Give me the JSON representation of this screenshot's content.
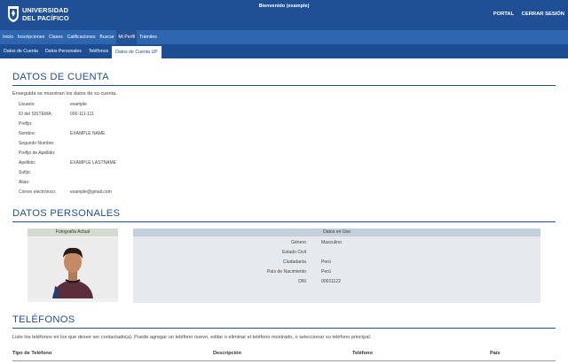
{
  "header": {
    "logo_line1": "UNIVERSIDAD",
    "logo_line2": "DEL PACÍFICO",
    "welcome": "Bienvenido (example)",
    "link_portal": "PORTAL",
    "link_logout": "CERRAR SESIÓN"
  },
  "menu": {
    "items": [
      "Inicio",
      "Inscripciones",
      "Clases",
      "Calificaciones",
      "Buscar",
      "Mi Perfil",
      "Trámites"
    ],
    "active": "Mi Perfil"
  },
  "submenu": {
    "items": [
      "Datos de Cuenta",
      "Datos Personales",
      "Teléfonos",
      "Datos de Cuenta UP"
    ],
    "active": "Datos de Cuenta UP"
  },
  "cuenta": {
    "title": "DATOS DE CUENTA",
    "intro": "Enseguida se muestran los datos de su cuenta.",
    "fields": [
      {
        "label": "Usuario:",
        "value": "example"
      },
      {
        "label": "ID del SISTEMA:",
        "value": "000-111-111"
      },
      {
        "label": "Prefijo:",
        "value": ""
      },
      {
        "label": "Nombre:",
        "value": "EXAMPLE NAME"
      },
      {
        "label": "Segundo Nombre:",
        "value": ""
      },
      {
        "label": "Prefijo de Apellido:",
        "value": ""
      },
      {
        "label": "Apellido:",
        "value": "EXAMPLE LASTNAME"
      },
      {
        "label": "Sufijo:",
        "value": ""
      },
      {
        "label": "Alias:",
        "value": ""
      },
      {
        "label": "Correo electrónico:",
        "value": "example@gmail.com"
      }
    ]
  },
  "personales": {
    "title": "DATOS PERSONALES",
    "photo_header": "Fotografía Actual",
    "data_header": "Datos en Uso",
    "rows": [
      {
        "label": "Género",
        "value": "Masculino"
      },
      {
        "label": "Estado Civil",
        "value": ""
      },
      {
        "label": "Ciudadanía",
        "value": "Perú"
      },
      {
        "label": "País de Nacimiento",
        "value": "Perú"
      },
      {
        "label": "DNI",
        "value": "00011122"
      }
    ]
  },
  "telefonos": {
    "title": "TELÉFONOS",
    "intro": "Liste los teléfonos en los que desee ser contactado(a). Puede agregar un teléfono nuevo, editar o eliminar el teléfono mostrado, o seleccionar su teléfono principal.",
    "columns": [
      "Tipo de Teléfono",
      "Descripción",
      "Teléfono",
      "País"
    ]
  },
  "colors": {
    "primary": "#1f4f94",
    "menu": "#2f66b0",
    "submenu": "#1d4e93"
  }
}
